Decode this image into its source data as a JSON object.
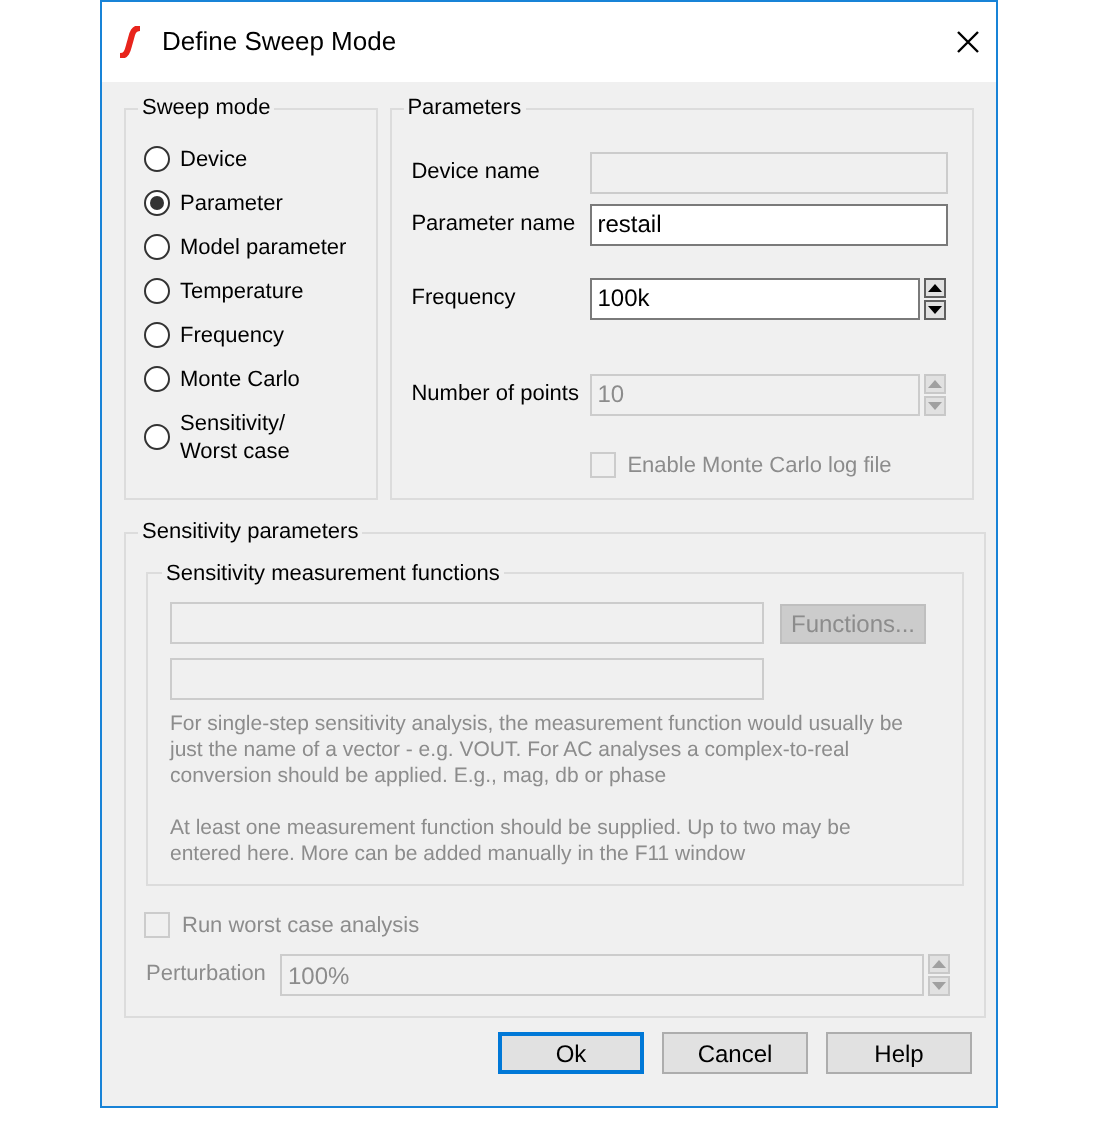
{
  "window": {
    "title": "Define Sweep Mode"
  },
  "sweep_mode": {
    "title": "Sweep mode",
    "options": [
      {
        "label": "Device",
        "selected": false
      },
      {
        "label": "Parameter",
        "selected": true
      },
      {
        "label": "Model parameter",
        "selected": false
      },
      {
        "label": "Temperature",
        "selected": false
      },
      {
        "label": "Frequency",
        "selected": false
      },
      {
        "label": "Monte Carlo",
        "selected": false
      },
      {
        "label": "Sensitivity/\nWorst case",
        "selected": false
      }
    ]
  },
  "parameters": {
    "title": "Parameters",
    "fields": [
      {
        "kind": "text",
        "label": "Device name",
        "disabled": true
      },
      {
        "kind": "text",
        "label": "Parameter name",
        "value": "restail",
        "disabled": false
      },
      {
        "kind": "spin",
        "label": "Frequency",
        "value": "100k",
        "disabled": false
      },
      {
        "kind": "spin",
        "label": "Number of points",
        "value": "10",
        "disabled": true
      }
    ],
    "log_checkbox": {
      "label": "Enable Monte Carlo log file",
      "checked": false,
      "disabled": true
    }
  },
  "sensitivity": {
    "title": "Sensitivity parameters",
    "functions": {
      "title": "Sensitivity measurement functions",
      "fields": [
        {
          "disabled": true
        },
        {
          "disabled": true
        }
      ],
      "button": {
        "label": "Functions...",
        "disabled": true
      },
      "notes": [
        "For single-step sensitivity analysis, the measurement function would usually be just the name of a vector - e.g. VOUT. For AC analyses a complex-to-real conversion should be applied. E.g., mag, db or phase",
        "At least one measurement function should be supplied. Up to two may be entered here. More can be added manually in the F11 window"
      ]
    },
    "worst_case": {
      "label": "Run worst case analysis",
      "checked": false,
      "disabled": true
    },
    "perturbation": {
      "label": "Perturbation",
      "value": "100%",
      "disabled": true
    }
  },
  "buttons": [
    {
      "label": "Ok",
      "default": true
    },
    {
      "label": "Cancel",
      "default": false
    },
    {
      "label": "Help",
      "default": false
    }
  ]
}
